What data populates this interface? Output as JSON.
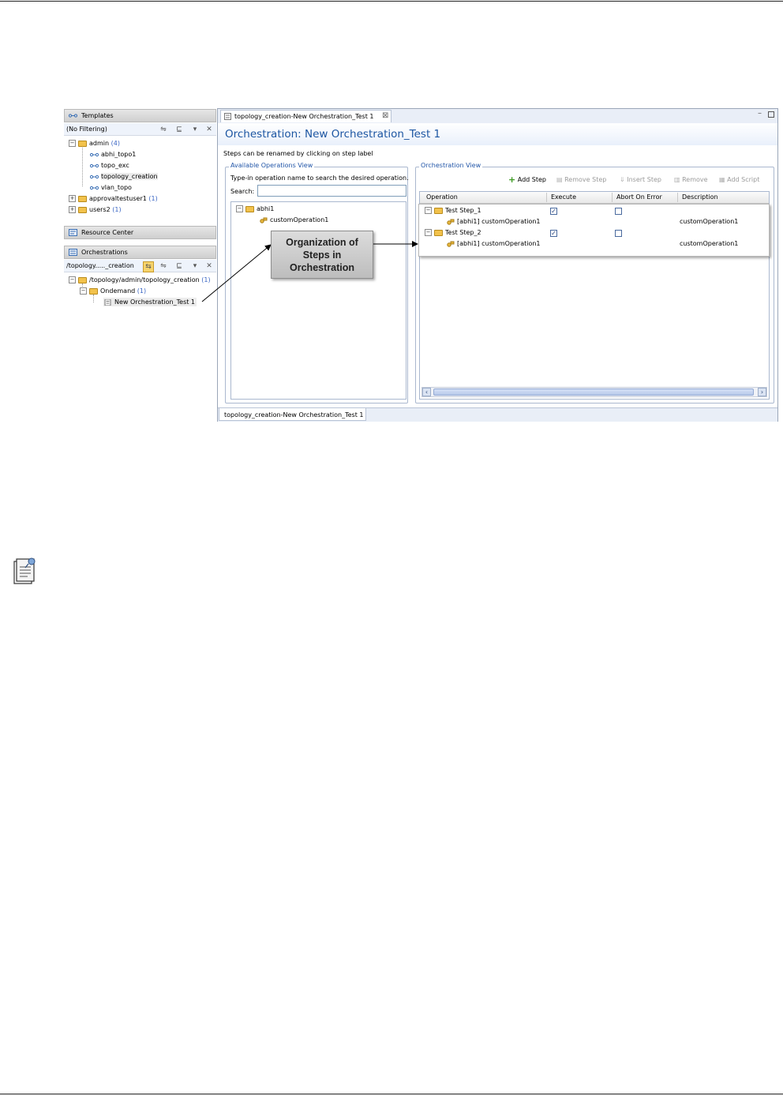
{
  "templates": {
    "title": "Templates",
    "filter": "(No Filtering)",
    "tree": [
      {
        "label": "admin",
        "count": "(4)"
      },
      {
        "label": "abhi_topo1"
      },
      {
        "label": "topo_exc"
      },
      {
        "label": "topology_creation"
      },
      {
        "label": "vlan_topo"
      },
      {
        "label": "approvaltestuser1",
        "count": "(1)"
      },
      {
        "label": "users2",
        "count": "(1)"
      }
    ]
  },
  "resource_center": {
    "title": "Resource Center"
  },
  "orchestrations": {
    "title": "Orchestrations",
    "filter": "/topology....._creation",
    "tree": [
      {
        "label": "/topology/admin/topology_creation",
        "count": "(1)"
      },
      {
        "label": "Ondemand",
        "count": "(1)"
      },
      {
        "label": "New Orchestration_Test 1"
      }
    ]
  },
  "editor": {
    "tab_label": "topology_creation-New Orchestration_Test 1",
    "form_title": "Orchestration: New Orchestration_Test 1",
    "hint": "Steps can be renamed by clicking on step label",
    "available": {
      "title": "Available Operations View",
      "instruction": "Type-in operation name to search the desired operation.",
      "search_label": "Search:",
      "search_value": "",
      "tree": [
        {
          "label": "abhi1"
        },
        {
          "label": "customOperation1"
        }
      ]
    },
    "orchestration": {
      "title": "Orchestration View",
      "toolbar": {
        "add_step": "Add Step",
        "remove_step": "Remove Step",
        "insert_step": "Insert Step",
        "remove": "Remove",
        "add_script": "Add Script"
      },
      "columns": [
        "Operation",
        "Execute",
        "Abort On Error",
        "Description"
      ],
      "rows": [
        {
          "label": "Test Step_1",
          "execute": true,
          "abort_on_error": false,
          "description": ""
        },
        {
          "label": "[abhi1] customOperation1",
          "description": "customOperation1"
        },
        {
          "label": "Test Step_2",
          "execute": true,
          "abort_on_error": false,
          "description": ""
        },
        {
          "label": "[abhi1] customOperation1",
          "description": "customOperation1"
        }
      ]
    },
    "bottom_tab": "topology_creation-New Orchestration_Test 1"
  },
  "callout": {
    "text": "Organization of Steps in Orchestration"
  },
  "icons": {
    "note": "note-icon",
    "folder": "folder-icon",
    "topology": "topology-icon",
    "operation": "operation-icon"
  }
}
